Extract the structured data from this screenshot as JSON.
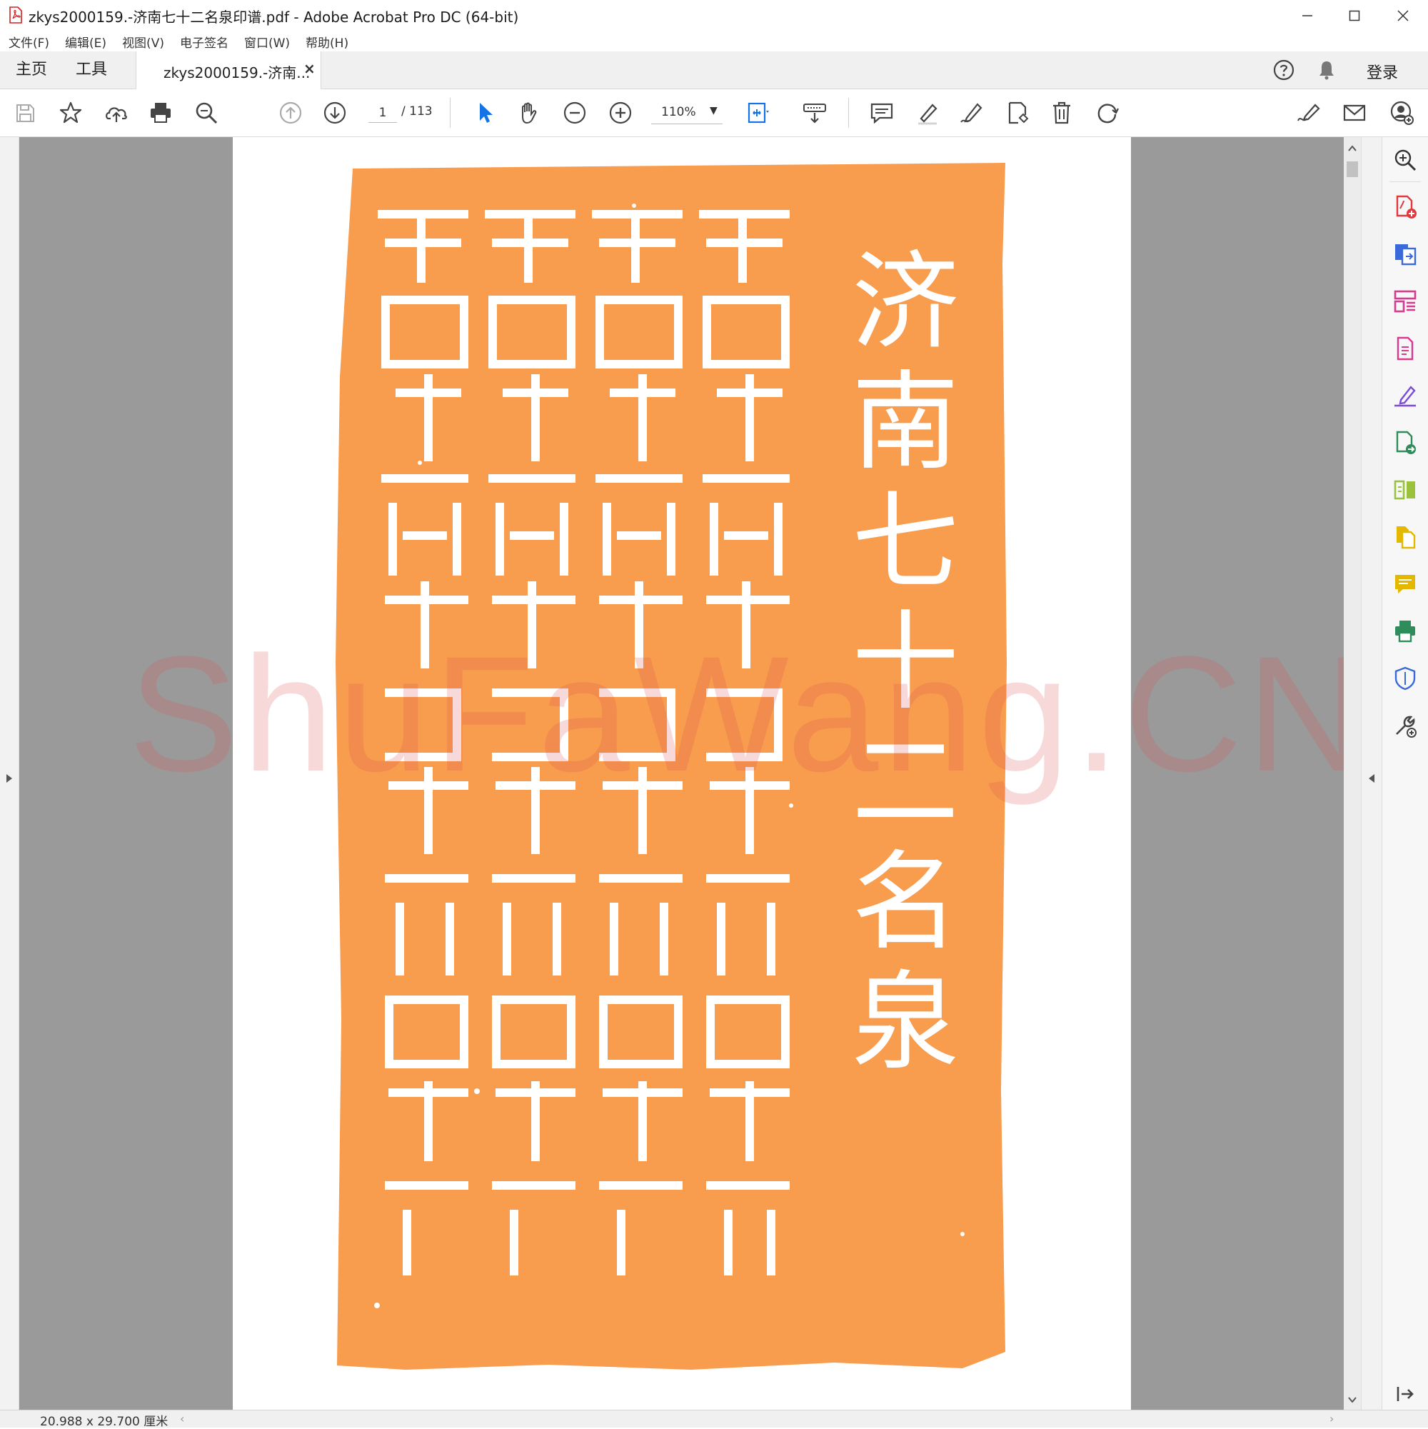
{
  "window": {
    "title": "zkys2000159.-济南七十二名泉印谱.pdf - Adobe Acrobat Pro DC (64-bit)"
  },
  "menu": [
    "文件(F)",
    "编辑(E)",
    "视图(V)",
    "电子签名",
    "窗口(W)",
    "帮助(H)"
  ],
  "tabs": {
    "home": "主页",
    "tools": "工具",
    "document": "zkys2000159.-济南...",
    "close": "×",
    "signin": "登录"
  },
  "toolbar": {
    "page_current": "1",
    "page_total": "/ 113",
    "zoom": "110%"
  },
  "document": {
    "seal_title": "济南七十二名泉",
    "seal_color": "#f89c4e",
    "watermark": "ShuFaWang.CN"
  },
  "status": {
    "page_size": "20.988 x 29.700 厘米"
  },
  "colors": {
    "accent_blue": "#1473e6",
    "acrobat_red": "#d4221f",
    "viewer_gray": "#9a9a9a"
  }
}
